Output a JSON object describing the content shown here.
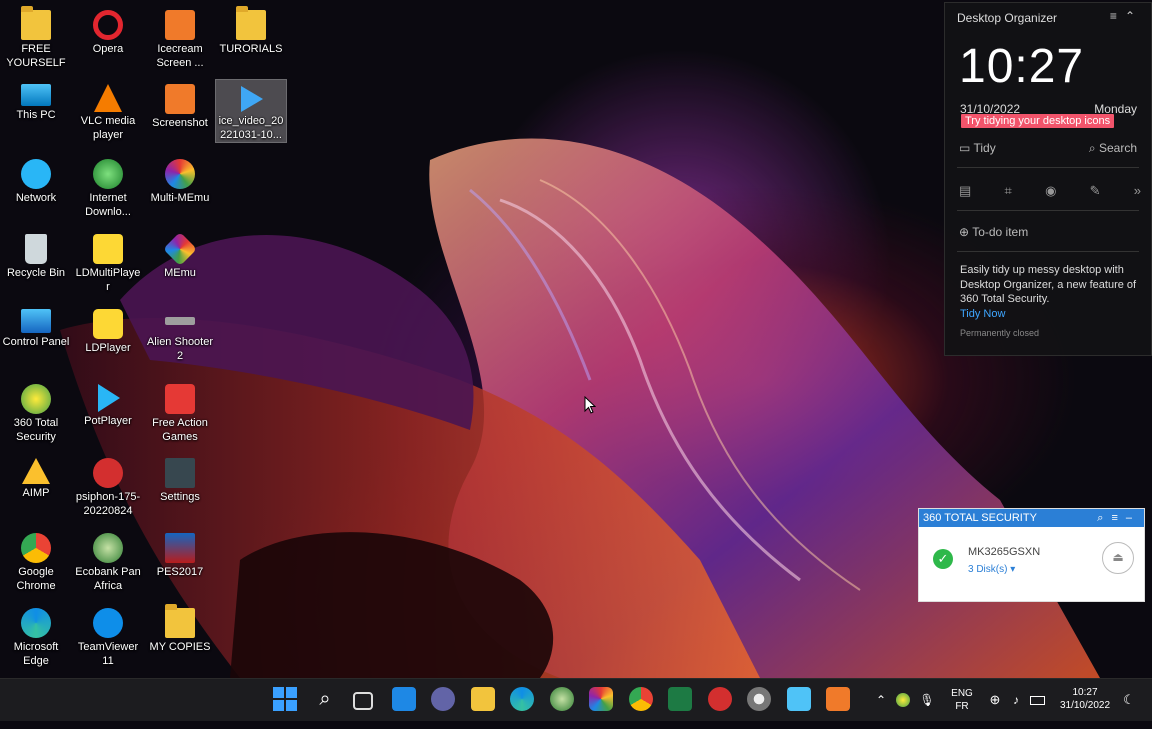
{
  "desktop_icons": [
    {
      "label": "FREE YOURSELF"
    },
    {
      "label": "Opera"
    },
    {
      "label": "Icecream Screen ..."
    },
    {
      "label": "TURORIALS"
    },
    {
      "label": "This PC"
    },
    {
      "label": "VLC media player"
    },
    {
      "label": "Screenshot"
    },
    {
      "label": "ice_video_20 221031-10..."
    },
    {
      "label": "Network"
    },
    {
      "label": "Internet Downlo..."
    },
    {
      "label": "Multi-MEmu"
    },
    {
      "label": "Recycle Bin"
    },
    {
      "label": "LDMultiPlaye r"
    },
    {
      "label": "MEmu"
    },
    {
      "label": "Control Panel"
    },
    {
      "label": "LDPlayer"
    },
    {
      "label": "Alien Shooter 2"
    },
    {
      "label": "360 Total Security"
    },
    {
      "label": "PotPlayer"
    },
    {
      "label": "Free Action Games"
    },
    {
      "label": "AIMP"
    },
    {
      "label": "psiphon-175-20220824"
    },
    {
      "label": "Settings"
    },
    {
      "label": "Google Chrome"
    },
    {
      "label": "Ecobank Pan Africa"
    },
    {
      "label": "PES2017"
    },
    {
      "label": "Microsoft Edge"
    },
    {
      "label": "TeamViewer 11"
    },
    {
      "label": "MY COPIES"
    }
  ],
  "organizer": {
    "title": "Desktop Organizer",
    "time": "10:27",
    "date": "31/10/2022",
    "day": "Monday",
    "tip": "Try tidying your desktop icons",
    "tidy": "Tidy",
    "search": "Search",
    "todo": "To-do item",
    "desc": "Easily tidy up messy desktop with Desktop Organizer, a new feature of 360 Total Security.",
    "tidy_now": "Tidy Now",
    "perm": "Permanently closed"
  },
  "security": {
    "title": "360 TOTAL SECURITY",
    "disk": "MK3265GSXN",
    "count": "3 Disk(s)"
  },
  "tray": {
    "lang1": "ENG",
    "lang2": "FR",
    "time": "10:27",
    "date": "31/10/2022"
  }
}
